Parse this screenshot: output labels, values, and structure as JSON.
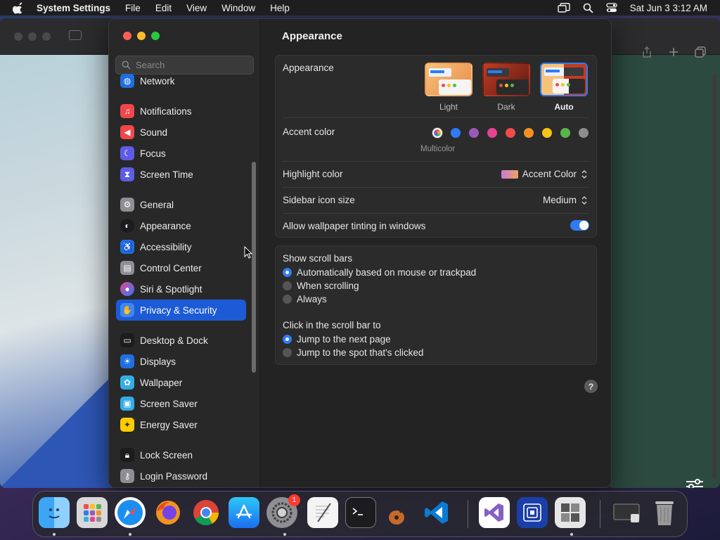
{
  "menubar": {
    "app_name": "System Settings",
    "menus": [
      "File",
      "Edit",
      "View",
      "Window",
      "Help"
    ],
    "clock": "Sat Jun 3  3:12 AM"
  },
  "sidebar": {
    "search_placeholder": "Search",
    "items": [
      {
        "label": "Network",
        "icon": "globe-icon",
        "color": "#1e6fe0"
      },
      {
        "label": "Notifications",
        "icon": "bell-icon",
        "color": "#f2464b"
      },
      {
        "label": "Sound",
        "icon": "speaker-icon",
        "color": "#f2464b"
      },
      {
        "label": "Focus",
        "icon": "moon-icon",
        "color": "#5e5ce6"
      },
      {
        "label": "Screen Time",
        "icon": "hourglass-icon",
        "color": "#5e5ce6"
      },
      {
        "label": "General",
        "icon": "gear-icon",
        "color": "#8e8e93"
      },
      {
        "label": "Appearance",
        "icon": "appearance-icon",
        "color": "#1c1c1e"
      },
      {
        "label": "Accessibility",
        "icon": "accessibility-icon",
        "color": "#1e6fe0"
      },
      {
        "label": "Control Center",
        "icon": "switches-icon",
        "color": "#8e8e93"
      },
      {
        "label": "Siri & Spotlight",
        "icon": "siri-icon",
        "color": "#7a3ee0"
      },
      {
        "label": "Privacy & Security",
        "icon": "hand-icon",
        "color": "#1e6fe0"
      },
      {
        "label": "Desktop & Dock",
        "icon": "dock-icon",
        "color": "#1c1c1e"
      },
      {
        "label": "Displays",
        "icon": "sun-icon",
        "color": "#1e6fe0"
      },
      {
        "label": "Wallpaper",
        "icon": "flower-icon",
        "color": "#32ade6"
      },
      {
        "label": "Screen Saver",
        "icon": "screen-saver-icon",
        "color": "#32ade6"
      },
      {
        "label": "Energy Saver",
        "icon": "bulb-icon",
        "color": "#ffcc00"
      },
      {
        "label": "Lock Screen",
        "icon": "lock-icon",
        "color": "#1c1c1e"
      },
      {
        "label": "Login Password",
        "icon": "key-icon",
        "color": "#8e8e93"
      }
    ]
  },
  "content": {
    "title": "Appearance",
    "appearance_label": "Appearance",
    "modes": [
      "Light",
      "Dark",
      "Auto"
    ],
    "accent_label": "Accent color",
    "accent_colors": [
      "multicolor",
      "#2f7bf5",
      "#9b59b6",
      "#e84393",
      "#f24b4b",
      "#f39222",
      "#f5c518",
      "#5bb54d",
      "#8e8e8e"
    ],
    "multicolor_label": "Multicolor",
    "highlight_label": "Highlight color",
    "highlight_value": "Accent Color",
    "icon_size_label": "Sidebar icon size",
    "icon_size_value": "Medium",
    "tinting_label": "Allow wallpaper tinting in windows",
    "tinting_on": true,
    "scroll_bars_label": "Show scroll bars",
    "scroll_options": [
      "Automatically based on mouse or trackpad",
      "When scrolling",
      "Always"
    ],
    "click_label": "Click in the scroll bar to",
    "click_options": [
      "Jump to the next page",
      "Jump to the spot that's clicked"
    ],
    "help": "?"
  },
  "dock": {
    "badge_count": "1",
    "apps": [
      "finder-icon",
      "launchpad-icon",
      "safari-icon",
      "firefox-icon",
      "chrome-icon",
      "app-store-icon",
      "system-settings-icon",
      "textedit-icon",
      "terminal-icon",
      "garageband-icon",
      "vscode-icon",
      "visual-studio-icon",
      "network-utility-icon",
      "boot-camp-icon",
      "screenshot-icon",
      "trash-icon"
    ]
  }
}
